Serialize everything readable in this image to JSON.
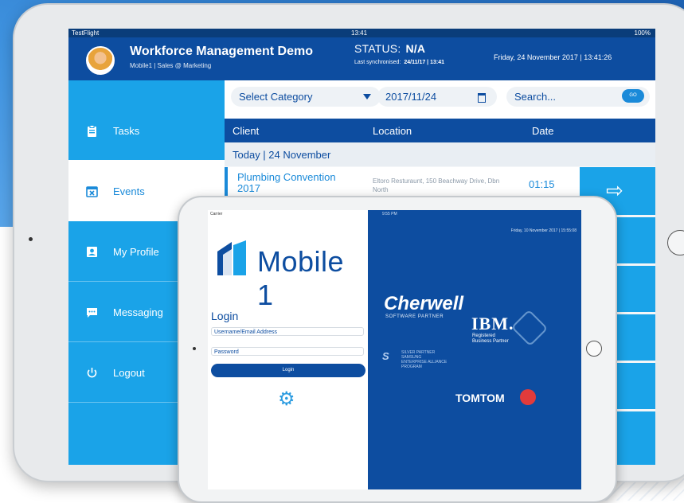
{
  "big_app": {
    "statusbar": {
      "carrier": "TestFlight",
      "time": "13:41",
      "battery": "100%"
    },
    "header": {
      "title": "Workforce Management Demo",
      "subtitle": "Mobile1 | Sales @ Marketing",
      "status_label": "STATUS:",
      "status_value": "N/A",
      "sync_label": "Last synchronised:",
      "sync_value": "24/11/17 | 13:41",
      "datetime": "Friday, 24 November 2017 | 13:41:26"
    },
    "sidebar": {
      "items": [
        {
          "label": "Tasks",
          "icon": "clipboard-icon"
        },
        {
          "label": "Events",
          "icon": "calendar-icon",
          "active": true
        },
        {
          "label": "My Profile",
          "icon": "profile-icon"
        },
        {
          "label": "Messaging",
          "icon": "chat-icon"
        },
        {
          "label": "Logout",
          "icon": "power-icon"
        }
      ]
    },
    "filters": {
      "category_placeholder": "Select Category",
      "date_value": "2017/11/24",
      "search_placeholder": "Search...",
      "go_label": "GO"
    },
    "table": {
      "headers": [
        "Client",
        "Location",
        "Date"
      ],
      "day_label": "Today | 24 November",
      "rows": [
        {
          "client": "Plumbing Convention 2017",
          "location": "Eltoro Resturaunt, 150 Beachway Drive, Dbn North",
          "date": "01:15"
        }
      ]
    }
  },
  "small_app": {
    "statusbar": {
      "carrier": "Carrier",
      "time": "9:55 PM"
    },
    "brand": "Mobile 1",
    "login": {
      "title": "Login",
      "username_placeholder": "Username/Email Address",
      "password_placeholder": "Password",
      "button_label": "Login"
    },
    "right_pane": {
      "datetime": "Friday, 10 November 2017 | 15:55:08",
      "partners": {
        "cherwell": "Cherwell",
        "cherwell_sub": "SOFTWARE PARTNER",
        "ibm": "IBM.",
        "ibm_sub_1": "Registered",
        "ibm_sub_2": "Business Partner",
        "samsung_1": "SILVER PARTNER",
        "samsung_2": "SAMSUNG",
        "samsung_3": "ENTERPRISE ALLIANCE",
        "samsung_4": "PROGRAM",
        "tomtom": "TOMTOM"
      }
    }
  }
}
